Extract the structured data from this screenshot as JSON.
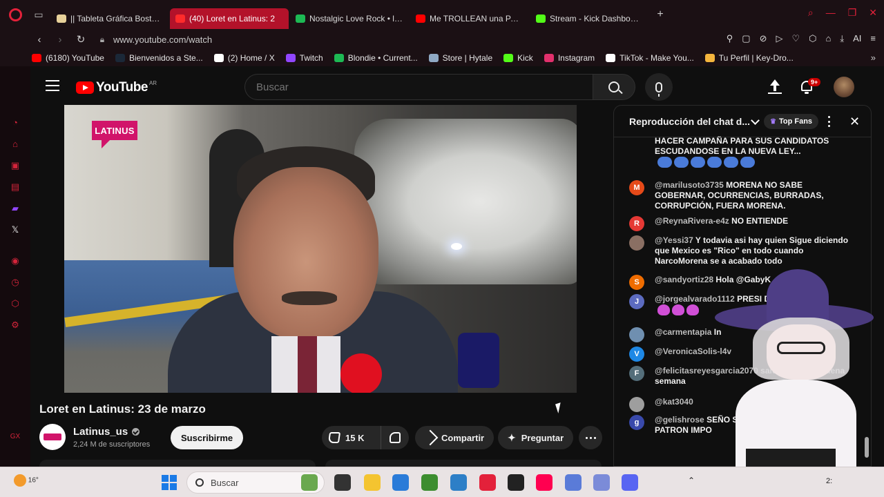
{
  "browser": {
    "tabs": [
      {
        "label": "|| Tableta Gráfica Bosto 12",
        "favicon_color": "#e7d19a",
        "active": false
      },
      {
        "label": "(40) Loret en Latinus: 2",
        "favicon_color": "#ff2b2b",
        "active": true
      },
      {
        "label": "Nostalgic Love Rock • late",
        "favicon_color": "#1db954",
        "active": false
      },
      {
        "label": "Me TROLLEAN una PARTIE",
        "favicon_color": "#ff0000",
        "active": false
      },
      {
        "label": "Stream - Kick Dashboard",
        "favicon_color": "#53fc18",
        "active": false
      }
    ],
    "new_tab": "+",
    "url": "www.youtube.com/watch",
    "address_actions": "AI",
    "bookmarks": [
      {
        "label": "(6180) YouTube",
        "color": "#ff0000"
      },
      {
        "label": "Bienvenidos a Ste...",
        "color": "#1b2838"
      },
      {
        "label": "(2) Home / X",
        "color": "#ffffff"
      },
      {
        "label": "Twitch",
        "color": "#9146ff"
      },
      {
        "label": "Blondie • Current...",
        "color": "#1db954"
      },
      {
        "label": "Store | Hytale",
        "color": "#8fa9c4"
      },
      {
        "label": "Kick",
        "color": "#53fc18"
      },
      {
        "label": "Instagram",
        "color": "#e1306c"
      },
      {
        "label": "TikTok - Make You...",
        "color": "#ffffff"
      },
      {
        "label": "Tu Perfil | Key-Dro...",
        "color": "#f4b53d"
      }
    ]
  },
  "opera_sidebar": {
    "icons": [
      "history-icon",
      "store-icon",
      "messenger-icon",
      "mail-icon",
      "twitch-icon",
      "x-icon",
      "player-icon",
      "clock-icon",
      "extensions-icon",
      "settings-icon"
    ],
    "bottom": "GX"
  },
  "youtube": {
    "logo": "YouTube",
    "region": "AR",
    "search_placeholder": "Buscar",
    "notification_badge": "9+",
    "video": {
      "channel_logo_text": "LATINUS",
      "title": "Loret en Latinus: 23 de marzo",
      "channel": "Latinus_us",
      "subscribers": "2,24 M de suscriptores",
      "subscribe_label": "Suscribirme",
      "likes": "15 K",
      "share_label": "Compartir",
      "ask_label": "Preguntar"
    },
    "chat": {
      "title": "Reproducción del chat d...",
      "filter_label": "Top Fans",
      "messages": [
        {
          "initial": "",
          "color": "#0f0f0f",
          "author": "",
          "text": "HACER CAMPAÑA PARA SUS CANDIDATOS ESCUDANDOSE EN LA NUEVA LEY...",
          "emoji": "blue",
          "emoji_count": 6
        },
        {
          "initial": "M",
          "color": "#e64a19",
          "author": "@marilusoto3735",
          "text": "MORENA NO SABE GOBERNAR, OCURRENCIAS, BURRADAS, CORRUPCIÓN, FUERA MORENA."
        },
        {
          "initial": "R",
          "color": "#e53935",
          "author": "@ReynaRivera-e4z",
          "text": "NO ENTIENDE"
        },
        {
          "initial": "",
          "color": "#8a6f63",
          "author": "@Yessi37",
          "text": "Y todavia asi hay quien Sigue diciendo que Mexico es \"Rico\" en todo cuando NarcoMorena se a acabado todo"
        },
        {
          "initial": "S",
          "color": "#ef6c00",
          "author": "@sandyortiz28",
          "text": "Hola @GabyK"
        },
        {
          "initial": "J",
          "color": "#5c6bc0",
          "author": "@jorgealvarado1112",
          "text": "PRESI DE INEPTA",
          "emoji": "poop",
          "emoji_count": 3
        },
        {
          "initial": "",
          "color": "#6f8fb0",
          "author": "@carmentapia",
          "text": "In"
        },
        {
          "initial": "V",
          "color": "#1e88e5",
          "author": "@VeronicaSolis-l4v",
          "text": ""
        },
        {
          "initial": "F",
          "color": "#546e7a",
          "author": "@felicitasreyesgarcia2070",
          "text": "saludos amiga buena semana"
        },
        {
          "initial": "",
          "color": "#9e9e9e",
          "author": "@kat3040",
          "text": ""
        },
        {
          "initial": "g",
          "color": "#3949ab",
          "author": "@gelishrose",
          "text": "SEÑO SABEMOS!!! CUAL SU PATRON IMPO"
        }
      ]
    }
  },
  "taskbar": {
    "temperature": "16°",
    "search_placeholder": "Buscar",
    "apps": [
      "nature-app-icon",
      "terminal-icon",
      "file-explorer-icon",
      "store-icon",
      "minecraft-icon",
      "photos-icon",
      "opera-gx-icon",
      "obs-icon",
      "tiktok-live-icon",
      "vtube-icon",
      "app-icon",
      "discord-icon"
    ],
    "app_colors": [
      "#6aa84f",
      "#333333",
      "#f4c430",
      "#2a7bd8",
      "#3c8d2f",
      "#2d7fc7",
      "#e3213a",
      "#222222",
      "#ff0050",
      "#5a7bd8",
      "#7b8bd8",
      "#5865f2"
    ],
    "clock": "2:"
  }
}
